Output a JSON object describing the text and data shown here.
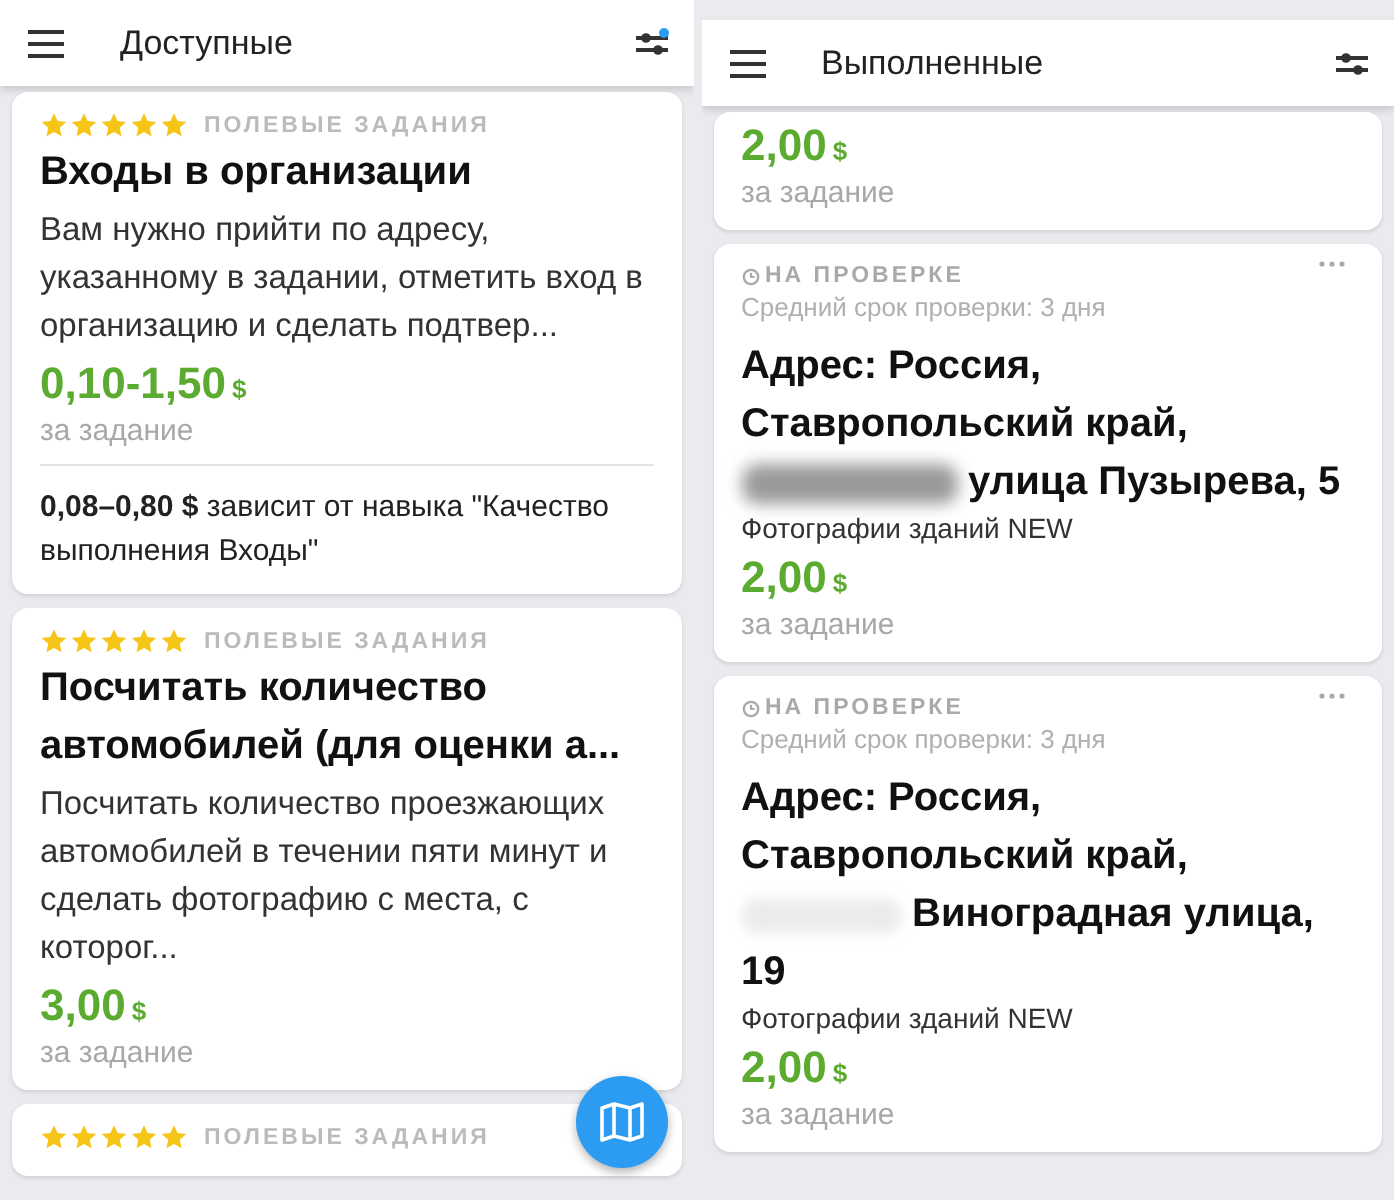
{
  "panels": [
    {
      "title": "Доступные",
      "filter_badge": true,
      "tasks": [
        {
          "kind": "available",
          "stars": 5,
          "category": "ПОЛЕВЫЕ ЗАДАНИЯ",
          "title": "Входы в организации",
          "description": "Вам нужно прийти по адресу, указанному в задании, отметить вход в организацию и сделать подтвер...",
          "price": "0,10-1,50",
          "currency": "$",
          "price_note": "за задание",
          "skill_note": "**0,08–0,80 $** зависит от навыка \"Качество выполнения Входы\""
        },
        {
          "kind": "available",
          "stars": 5,
          "category": "ПОЛЕВЫЕ ЗАДАНИЯ",
          "title": "Посчитать количество автомобилей (для оценки а...",
          "description": "Посчитать количество проезжающих автомобилей в течении пяти минут и сделать фотографию с места, с которог...",
          "price": "3,00",
          "currency": "$",
          "price_note": "за задание"
        },
        {
          "kind": "available",
          "stars": 5,
          "category": "ПОЛЕВЫЕ ЗАДАНИЯ"
        }
      ]
    },
    {
      "title": "Выполненные",
      "filter_badge": false,
      "tasks": [
        {
          "kind": "done",
          "price": "2,00",
          "currency": "$",
          "price_note": "за задание"
        },
        {
          "kind": "done",
          "status": "НА ПРОВЕРКЕ",
          "review_time": "Средний срок проверки: 3 дня",
          "title_parts": [
            {
              "kind": "text",
              "text": "Адрес: Россия, Ставропольский край, "
            },
            {
              "kind": "redacted"
            },
            {
              "kind": "text",
              "text": " улица Пузырева, 5"
            }
          ],
          "subtitle": "Фотографии зданий NEW",
          "price": "2,00",
          "currency": "$",
          "price_note": "за задание"
        },
        {
          "kind": "done",
          "status": "НА ПРОВЕРКЕ",
          "review_time": "Средний срок проверки: 3 дня",
          "title_parts": [
            {
              "kind": "text",
              "text": "Адрес: Россия, Ставропольский край, "
            },
            {
              "kind": "faded"
            },
            {
              "kind": "text",
              "text": " Виноградная улица, 19"
            }
          ],
          "subtitle": "Фотографии зданий NEW",
          "price": "2,00",
          "currency": "$",
          "price_note": "за задание"
        }
      ]
    }
  ]
}
